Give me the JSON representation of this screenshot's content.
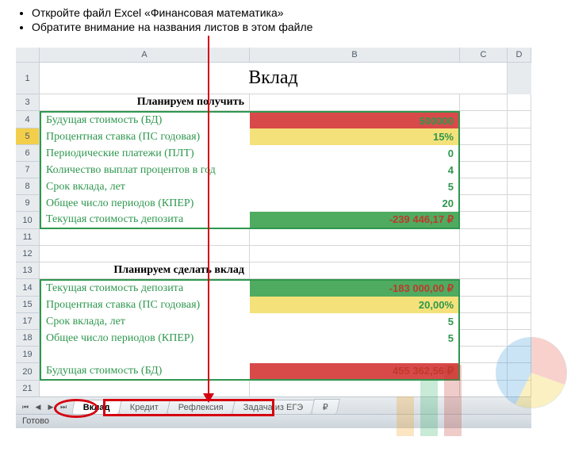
{
  "instructions": {
    "item1": "Откройте файл Excel «Финансовая математика»",
    "item2": "Обратите внимание на названия листов в этом файле"
  },
  "columns": {
    "a": "A",
    "b": "B",
    "c": "C",
    "d": "D"
  },
  "rows": {
    "r1": "1",
    "r3": "3",
    "r4": "4",
    "r5": "5",
    "r6": "6",
    "r7": "7",
    "r8": "8",
    "r9": "9",
    "r10": "10",
    "r11": "11",
    "r12": "12",
    "r13": "13",
    "r14": "14",
    "r15": "15",
    "r17": "17",
    "r18": "18",
    "r19": "19",
    "r20": "20",
    "r21": "21"
  },
  "sheet": {
    "title": "Вклад",
    "section1": "Планируем получить",
    "section2": "Планируем сделать вклад",
    "block1": {
      "l1": "Будущая стоимость (БД)",
      "v1": "500000",
      "l2": "Процентная ставка (ПС годовая)",
      "v2": "15%",
      "l3": "Периодические платежи (ПЛТ)",
      "v3": "0",
      "l4": "Количество выплат процентов в год",
      "v4": "4",
      "l5": "Срок вклада, лет",
      "v5": "5",
      "l6": "Общее число периодов (КПЕР)",
      "v6": "20",
      "l7": "Текущая стоимость депозита",
      "v7": "-239 446,17 ₽"
    },
    "block2": {
      "l1": "Текущая стоимость депозита",
      "v1": "-183 000,00 ₽",
      "l2": "Процентная ставка (ПС годовая)",
      "v2": "20,00%",
      "l3": "Срок вклада, лет",
      "v3": "5",
      "l4": "Общее число периодов (КПЕР)",
      "v4": "5",
      "l5": "Будущая стоимость (БД)",
      "v5": "455 362,56 ₽"
    }
  },
  "tabs": {
    "t1": "Вклад",
    "t2": "Кредит",
    "t3": "Рефлексия",
    "t4": "Задача из ЕГЭ",
    "t5": "₽"
  },
  "status": "Готово"
}
